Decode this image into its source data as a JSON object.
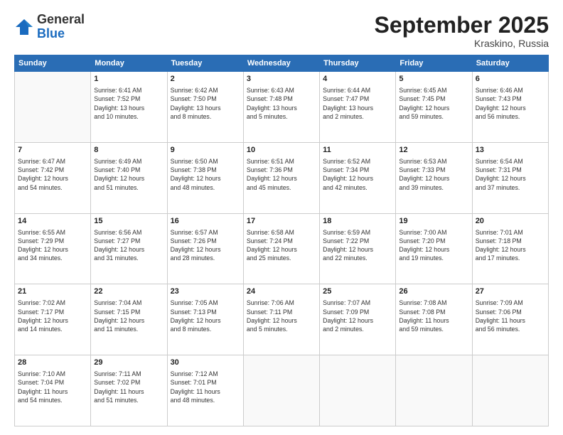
{
  "header": {
    "logo_general": "General",
    "logo_blue": "Blue",
    "month_title": "September 2025",
    "location": "Kraskino, Russia"
  },
  "days_of_week": [
    "Sunday",
    "Monday",
    "Tuesday",
    "Wednesday",
    "Thursday",
    "Friday",
    "Saturday"
  ],
  "weeks": [
    [
      {
        "day": "",
        "info": ""
      },
      {
        "day": "1",
        "info": "Sunrise: 6:41 AM\nSunset: 7:52 PM\nDaylight: 13 hours\nand 10 minutes."
      },
      {
        "day": "2",
        "info": "Sunrise: 6:42 AM\nSunset: 7:50 PM\nDaylight: 13 hours\nand 8 minutes."
      },
      {
        "day": "3",
        "info": "Sunrise: 6:43 AM\nSunset: 7:48 PM\nDaylight: 13 hours\nand 5 minutes."
      },
      {
        "day": "4",
        "info": "Sunrise: 6:44 AM\nSunset: 7:47 PM\nDaylight: 13 hours\nand 2 minutes."
      },
      {
        "day": "5",
        "info": "Sunrise: 6:45 AM\nSunset: 7:45 PM\nDaylight: 12 hours\nand 59 minutes."
      },
      {
        "day": "6",
        "info": "Sunrise: 6:46 AM\nSunset: 7:43 PM\nDaylight: 12 hours\nand 56 minutes."
      }
    ],
    [
      {
        "day": "7",
        "info": "Sunrise: 6:47 AM\nSunset: 7:42 PM\nDaylight: 12 hours\nand 54 minutes."
      },
      {
        "day": "8",
        "info": "Sunrise: 6:49 AM\nSunset: 7:40 PM\nDaylight: 12 hours\nand 51 minutes."
      },
      {
        "day": "9",
        "info": "Sunrise: 6:50 AM\nSunset: 7:38 PM\nDaylight: 12 hours\nand 48 minutes."
      },
      {
        "day": "10",
        "info": "Sunrise: 6:51 AM\nSunset: 7:36 PM\nDaylight: 12 hours\nand 45 minutes."
      },
      {
        "day": "11",
        "info": "Sunrise: 6:52 AM\nSunset: 7:34 PM\nDaylight: 12 hours\nand 42 minutes."
      },
      {
        "day": "12",
        "info": "Sunrise: 6:53 AM\nSunset: 7:33 PM\nDaylight: 12 hours\nand 39 minutes."
      },
      {
        "day": "13",
        "info": "Sunrise: 6:54 AM\nSunset: 7:31 PM\nDaylight: 12 hours\nand 37 minutes."
      }
    ],
    [
      {
        "day": "14",
        "info": "Sunrise: 6:55 AM\nSunset: 7:29 PM\nDaylight: 12 hours\nand 34 minutes."
      },
      {
        "day": "15",
        "info": "Sunrise: 6:56 AM\nSunset: 7:27 PM\nDaylight: 12 hours\nand 31 minutes."
      },
      {
        "day": "16",
        "info": "Sunrise: 6:57 AM\nSunset: 7:26 PM\nDaylight: 12 hours\nand 28 minutes."
      },
      {
        "day": "17",
        "info": "Sunrise: 6:58 AM\nSunset: 7:24 PM\nDaylight: 12 hours\nand 25 minutes."
      },
      {
        "day": "18",
        "info": "Sunrise: 6:59 AM\nSunset: 7:22 PM\nDaylight: 12 hours\nand 22 minutes."
      },
      {
        "day": "19",
        "info": "Sunrise: 7:00 AM\nSunset: 7:20 PM\nDaylight: 12 hours\nand 19 minutes."
      },
      {
        "day": "20",
        "info": "Sunrise: 7:01 AM\nSunset: 7:18 PM\nDaylight: 12 hours\nand 17 minutes."
      }
    ],
    [
      {
        "day": "21",
        "info": "Sunrise: 7:02 AM\nSunset: 7:17 PM\nDaylight: 12 hours\nand 14 minutes."
      },
      {
        "day": "22",
        "info": "Sunrise: 7:04 AM\nSunset: 7:15 PM\nDaylight: 12 hours\nand 11 minutes."
      },
      {
        "day": "23",
        "info": "Sunrise: 7:05 AM\nSunset: 7:13 PM\nDaylight: 12 hours\nand 8 minutes."
      },
      {
        "day": "24",
        "info": "Sunrise: 7:06 AM\nSunset: 7:11 PM\nDaylight: 12 hours\nand 5 minutes."
      },
      {
        "day": "25",
        "info": "Sunrise: 7:07 AM\nSunset: 7:09 PM\nDaylight: 12 hours\nand 2 minutes."
      },
      {
        "day": "26",
        "info": "Sunrise: 7:08 AM\nSunset: 7:08 PM\nDaylight: 11 hours\nand 59 minutes."
      },
      {
        "day": "27",
        "info": "Sunrise: 7:09 AM\nSunset: 7:06 PM\nDaylight: 11 hours\nand 56 minutes."
      }
    ],
    [
      {
        "day": "28",
        "info": "Sunrise: 7:10 AM\nSunset: 7:04 PM\nDaylight: 11 hours\nand 54 minutes."
      },
      {
        "day": "29",
        "info": "Sunrise: 7:11 AM\nSunset: 7:02 PM\nDaylight: 11 hours\nand 51 minutes."
      },
      {
        "day": "30",
        "info": "Sunrise: 7:12 AM\nSunset: 7:01 PM\nDaylight: 11 hours\nand 48 minutes."
      },
      {
        "day": "",
        "info": ""
      },
      {
        "day": "",
        "info": ""
      },
      {
        "day": "",
        "info": ""
      },
      {
        "day": "",
        "info": ""
      }
    ]
  ]
}
